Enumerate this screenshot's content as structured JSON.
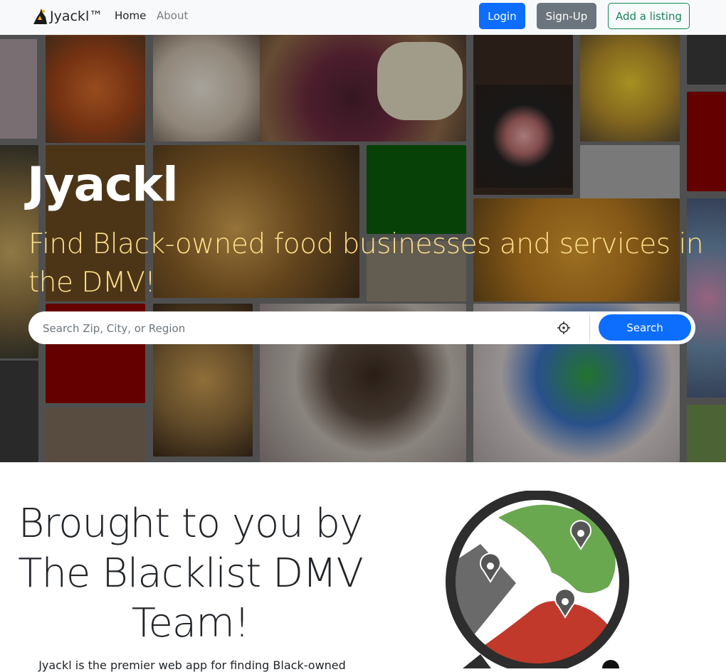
{
  "navbar": {
    "brand": "Jyackl™",
    "links": [
      "Home",
      "About"
    ],
    "login_label": "Login",
    "signup_label": "Sign-Up",
    "add_listing_label": "Add a listing"
  },
  "hero": {
    "title": "Jyackl",
    "subtitle": "Find Black-owned food businesses and services in the DMV!",
    "search": {
      "placeholder": "Search Zip, City, or Region",
      "value": "",
      "button_label": "Search"
    }
  },
  "info": {
    "heading": "Brought to you by The Blacklist DMV Team!",
    "text": "Jyackl is the premier web app for finding Black-owned"
  },
  "colors": {
    "primary": "#0d6efd",
    "secondary": "#6c757d",
    "success": "#198754",
    "hero_subtitle": "#ffe08a"
  },
  "icons": {
    "brand": "brand-logo-icon",
    "locate": "crosshair-icon",
    "map": "dmv-map-icon"
  }
}
